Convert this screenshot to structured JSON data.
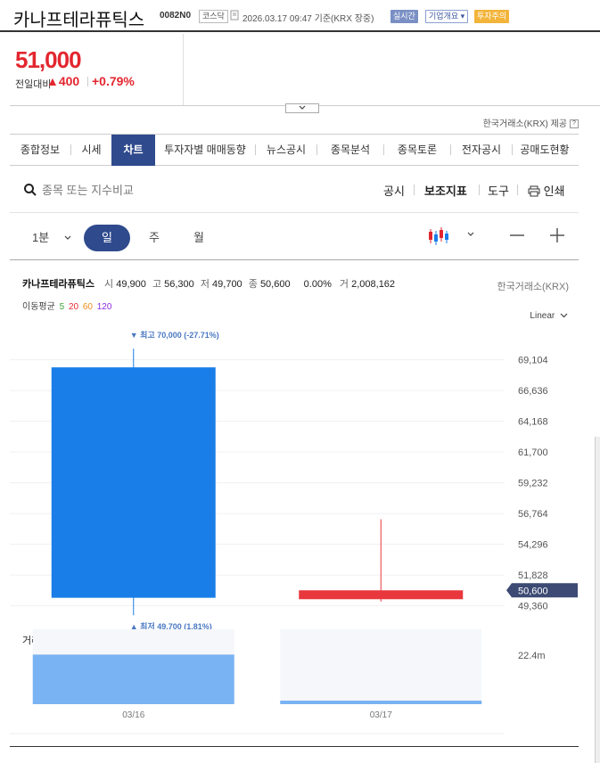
{
  "header": {
    "title": "카나프테라퓨틱스",
    "code": "0082N0",
    "market_tag": "코스닥",
    "datetime": "2026.03.17 09:47",
    "basis": "기준(KRX 장중)",
    "realtime_badge": "실시간",
    "company_badge": "기업개요 ▾",
    "warning_badge": "투자주의",
    "colors": {
      "realtime": "#7a8fc4",
      "company": "#c4cde6",
      "warning": "#f2b43a"
    }
  },
  "quote": {
    "price": "51,000",
    "prev_label": "전일대비",
    "change_amount": "▲400",
    "change_percent": "+0.79%",
    "up_color": "#e3262f"
  },
  "source_note": "한국거래소(KRX) 제공",
  "tabs": [
    {
      "label": "종합정보"
    },
    {
      "label": "시세"
    },
    {
      "label": "차트"
    },
    {
      "label": "투자자별 매매동향"
    },
    {
      "label": "뉴스공시"
    },
    {
      "label": "종목분석"
    },
    {
      "label": "종목토론"
    },
    {
      "label": "전자공시"
    },
    {
      "label": "공매도현황"
    }
  ],
  "toolbar": {
    "search_placeholder": "종목 또는 지수비교",
    "disclosure": "공시",
    "indicators": "보조지표",
    "tools": "도구",
    "print": "인쇄"
  },
  "periods": {
    "interval": "1분",
    "day": "일",
    "week": "주",
    "month": "월",
    "selected": "일"
  },
  "chart_info": {
    "name": "카나프테라퓨틱스",
    "open_label": "시",
    "open": "49,900",
    "high_label": "고",
    "high": "56,300",
    "low_label": "저",
    "low": "49,700",
    "close_label": "종",
    "close": "50,600",
    "change": "0.00%",
    "volume_label": "거",
    "volume": "2,008,162",
    "source": "한국거래소(KRX)",
    "ma_label": "이동평균",
    "ma": [
      {
        "period": "5",
        "color": "#3aa63a"
      },
      {
        "period": "20",
        "color": "#e3262f"
      },
      {
        "period": "60",
        "color": "#f08c1a"
      },
      {
        "period": "120",
        "color": "#8a2be2"
      }
    ],
    "scale": "Linear",
    "colors": {
      "up": "#e8383d",
      "down": "#1a7ee8",
      "volume": "#7ab3f3",
      "price_tag": "#3c4a74"
    }
  },
  "chart_data": {
    "type": "candlestick",
    "categories": [
      "03/16",
      "03/17"
    ],
    "candles": [
      {
        "date": "03/16",
        "open": 68500,
        "high": 70000,
        "low": 48600,
        "close": 50000
      },
      {
        "date": "03/17",
        "open": 49900,
        "high": 56300,
        "low": 49700,
        "close": 50600
      }
    ],
    "volume": [
      2980000,
      60000
    ],
    "volume_label": "거래량",
    "volume_value": "2,008,162",
    "volume_axis_label": "22.4m",
    "y_ticks": [
      "69,104",
      "66,636",
      "64,168",
      "61,700",
      "59,232",
      "56,764",
      "54,296",
      "51,828",
      "49,360"
    ],
    "y_tick_values": [
      69104,
      66636,
      64168,
      61700,
      59232,
      56764,
      54296,
      51828,
      49360
    ],
    "current_price_label": "50,600",
    "current_price": 50600,
    "max_annotation": "▼ 최고 70,000 (-27.71%)",
    "min_annotation": "▲ 최저 49,700 (1.81%)",
    "ylim": [
      48400,
      71300
    ],
    "volume_max": 3000000
  }
}
